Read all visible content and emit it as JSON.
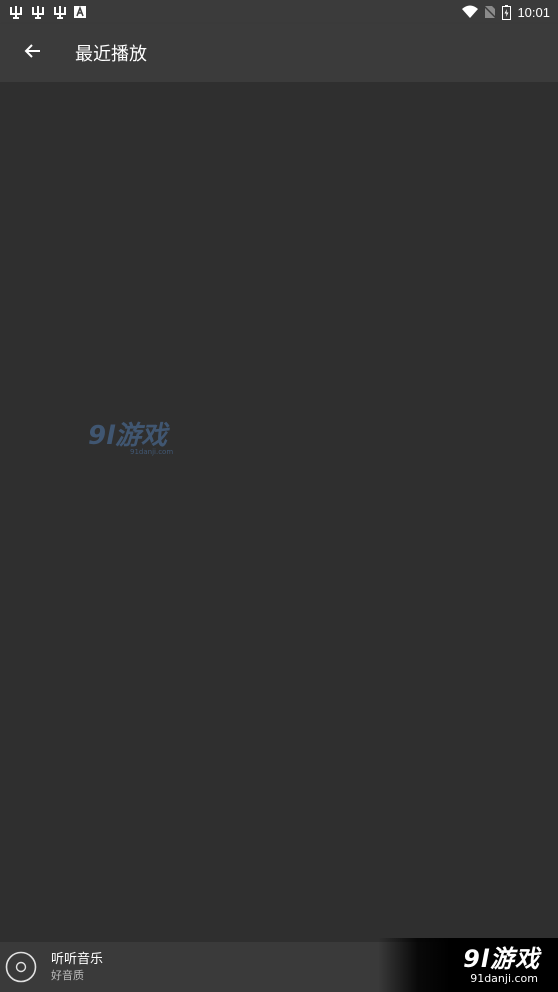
{
  "status_bar": {
    "time": "10:01",
    "left_icons": [
      "bug-icon",
      "bug-icon",
      "bug-icon",
      "a-letter-icon"
    ],
    "right_icons": [
      "wifi-icon",
      "no-sim-icon",
      "battery-icon"
    ]
  },
  "app_bar": {
    "title": "最近播放",
    "back_icon": "arrow-left-icon"
  },
  "mini_player": {
    "title": "听听音乐",
    "subtitle": "好音质",
    "icon": "disc-icon"
  },
  "watermark": {
    "center_logo": "9l游戏",
    "center_domain": "91danji.com",
    "corner_logo": "9l游戏",
    "corner_domain": "91danji.com"
  },
  "colors": {
    "background": "#2f2f2f",
    "app_bar": "#3b3b3b",
    "mini_player": "#3a3a3a",
    "watermark_blue": "#4f77a8"
  }
}
